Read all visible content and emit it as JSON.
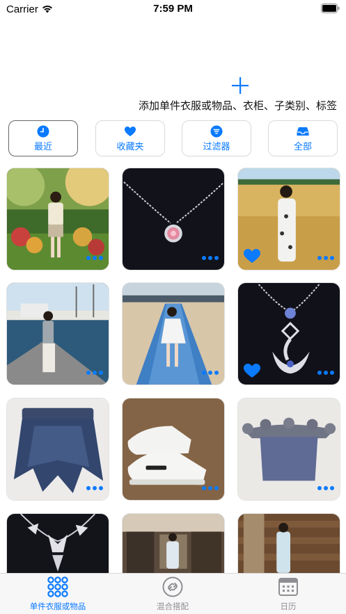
{
  "status_bar": {
    "carrier": "Carrier",
    "time": "7:59 PM"
  },
  "header": {
    "add_label": "添加单件衣服或物品、衣柜、子类别、标签"
  },
  "filters": [
    {
      "label": "最近",
      "icon": "clock-icon",
      "active": true
    },
    {
      "label": "收藏夹",
      "icon": "heart-icon",
      "active": false
    },
    {
      "label": "过滤器",
      "icon": "filter-icon",
      "active": false
    },
    {
      "label": "全部",
      "icon": "tray-icon",
      "active": false
    }
  ],
  "grid": {
    "items": [
      {
        "subject": "woman-in-garden-photo",
        "favorite": false
      },
      {
        "subject": "pink-pendant-necklace-photo",
        "favorite": false
      },
      {
        "subject": "woman-in-wheat-field-photo",
        "favorite": true
      },
      {
        "subject": "woman-at-harbor-photo",
        "favorite": false
      },
      {
        "subject": "woman-on-beach-walkway-photo",
        "favorite": false
      },
      {
        "subject": "swan-pendant-necklace-photo",
        "favorite": true
      },
      {
        "subject": "tulle-skirt-photo",
        "favorite": false
      },
      {
        "subject": "white-sneakers-photo",
        "favorite": false
      },
      {
        "subject": "off-shoulder-top-photo",
        "favorite": false
      },
      {
        "subject": "butterfly-necklace-photo",
        "favorite": false
      },
      {
        "subject": "woman-in-mall-photo",
        "favorite": false
      },
      {
        "subject": "woman-by-log-cabin-photo",
        "favorite": false
      }
    ]
  },
  "tabs": [
    {
      "label": "单件衣服或物品",
      "icon": "grid-icon",
      "active": true
    },
    {
      "label": "混合搭配",
      "icon": "link-icon",
      "active": false
    },
    {
      "label": "日历",
      "icon": "calendar-icon",
      "active": false
    }
  ],
  "colors": {
    "accent": "#0a7aff",
    "inactive": "#8e8e93"
  }
}
